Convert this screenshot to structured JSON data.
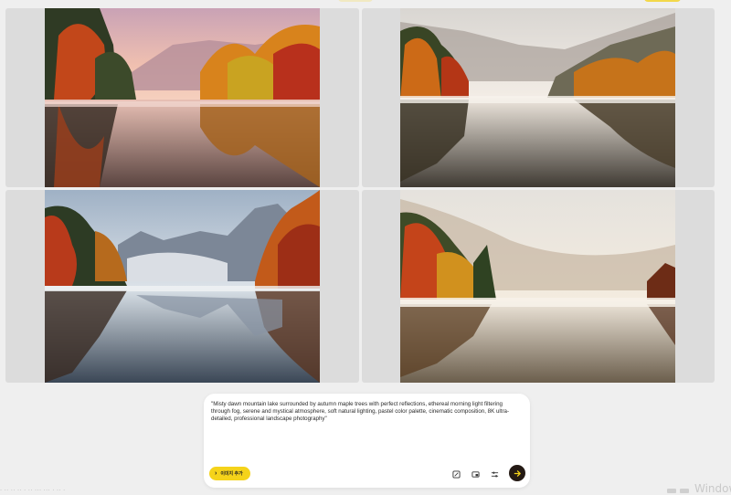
{
  "gallery": {
    "images": [
      {
        "scene": "autumn lake at pink dawn with mirrored forest",
        "sky": "#e9b8b4",
        "water": "#8a7268"
      },
      {
        "scene": "misty valley lake with autumn trees and mountains",
        "sky": "#ebe6e1",
        "water": "#b5ab9f"
      },
      {
        "scene": "alpine lake with rocky peaks and autumn forest",
        "sky": "#c9d3dc",
        "water": "#7f8fa0"
      },
      {
        "scene": "foggy autumn lake at golden hour",
        "sky": "#efe6d8",
        "water": "#b9ad9b"
      }
    ]
  },
  "prompt": {
    "text": "\"Misty dawn mountain lake surrounded by autumn maple trees with perfect reflections, ethereal morning light filtering through fog, serene and mystical atmosphere, soft natural lighting, pastel color palette, cinematic composition, 8K ultra-detailed, professional landscape photography\"",
    "add_image_label": "이미지 추가",
    "icons": [
      "crop-icon",
      "aspect-ratio-icon",
      "settings-sliders-icon",
      "send-arrow-icon"
    ]
  },
  "colors": {
    "accent_yellow": "#f5d31a",
    "send_button": "#241a14",
    "card_bg": "#ffffff",
    "page_bg": "#efefef"
  },
  "footer": {
    "left_text": "· ·· ·· ·· ·  ··  ··· ···  · ·· ·",
    "watermark": "Window"
  }
}
